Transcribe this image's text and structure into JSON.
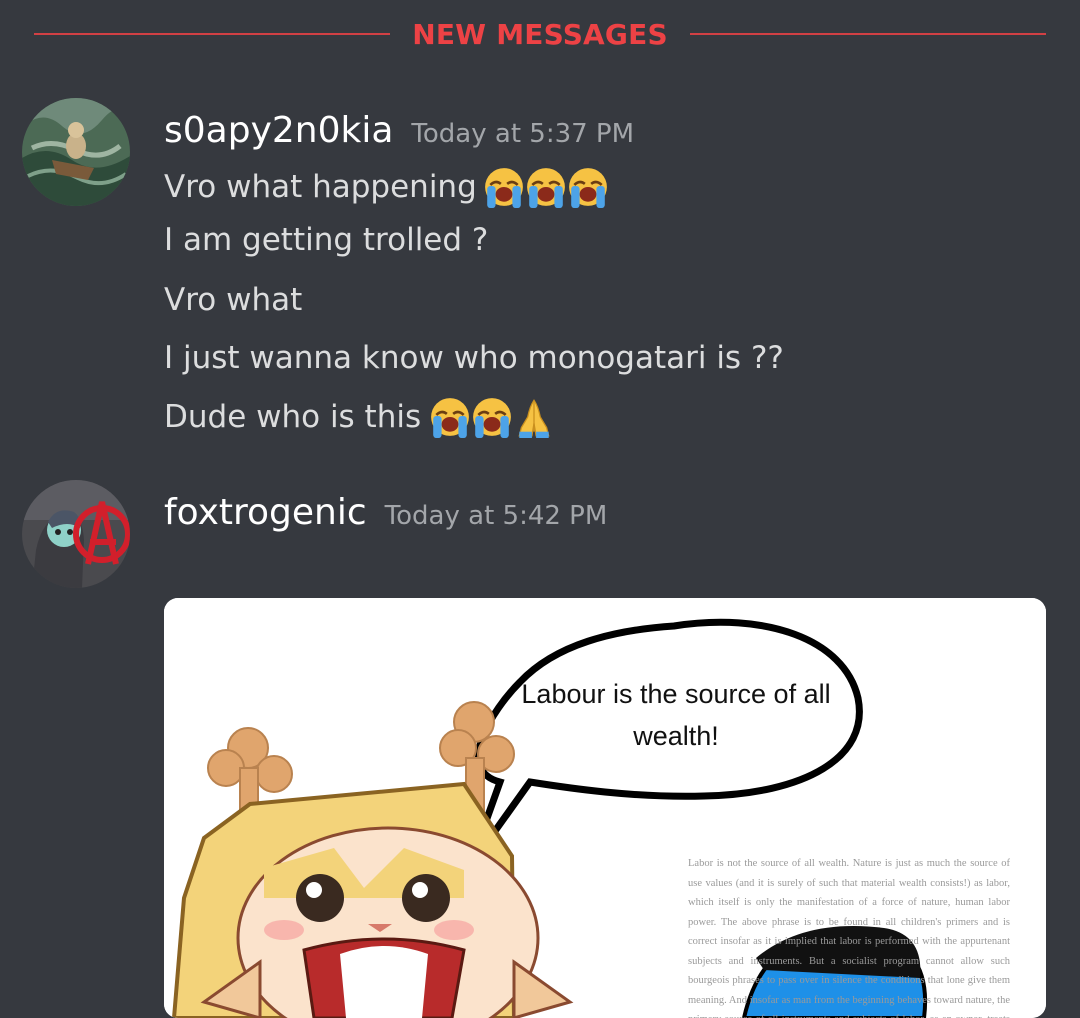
{
  "divider": {
    "label": "NEW MESSAGES"
  },
  "messages": [
    {
      "username": "s0apy2n0kia",
      "timestamp": "Today at 5:37 PM",
      "lines": [
        "Vro what happening",
        "I am getting trolled ?",
        "Vro what",
        "I just wanna know who  monogatari is ??",
        "Dude who is this"
      ],
      "emojis": {
        "line0": [
          "loudly-crying-face",
          "loudly-crying-face",
          "loudly-crying-face"
        ],
        "line4": [
          "loudly-crying-face",
          "loudly-crying-face",
          "folded-hands"
        ]
      }
    },
    {
      "username": "foxtrogenic",
      "timestamp": "Today at 5:42 PM",
      "attachment": {
        "speech_bubble": "Labour is the source of all wealth!",
        "book_excerpt": "Labor is not the source of all wealth. Nature is just as much the source of use values (and it is surely of such that material wealth consists!) as labor, which itself is only the manifestation of a force of nature, human labor power. The above phrase is to be found in all children's primers and is correct insofar as it is implied that labor is performed with the appurtenant subjects and instruments. But a socialist program cannot allow such bourgeois phrases to pass over in silence the conditions that lone give them meaning. And insofar as man from the beginning behaves toward nature, the primary source of all instruments and subjects of labor, as an owner, treats her as belonging to him, his labor becomes the source of"
      }
    }
  ],
  "colors": {
    "background": "#36393f",
    "divider": "#ed4245",
    "username": "#ffffff",
    "timestamp": "#a3a6aa",
    "text": "#dcddde"
  }
}
